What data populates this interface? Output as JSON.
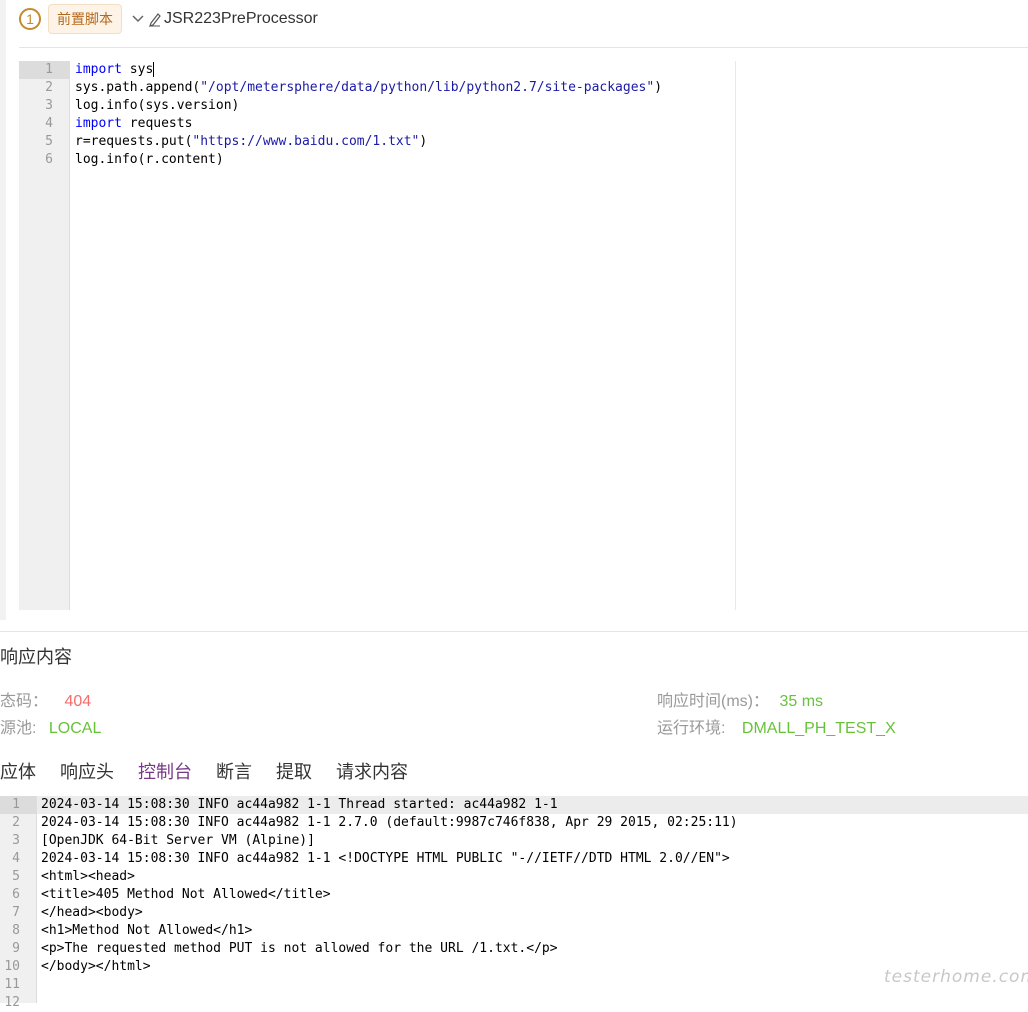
{
  "header": {
    "step_number": "1",
    "tag_label": "前置脚本",
    "title": "JSR223PreProcessor"
  },
  "editor": {
    "line_numbers": [
      "1",
      "2",
      "3",
      "4",
      "5",
      "6"
    ],
    "lines": [
      {
        "kw": "import",
        "rest": " sys"
      },
      {
        "plain": "sys.path.append(",
        "str": "\"/opt/metersphere/data/python/lib/python2.7/site-packages\"",
        "tail": ")"
      },
      {
        "plain": "log.info(sys.version)"
      },
      {
        "kw": "import",
        "rest": " requests"
      },
      {
        "plain": "r=requests.put(",
        "str": "\"https://www.baidu.com/1.txt\"",
        "tail": ")"
      },
      {
        "plain": "log.info(r.content)"
      }
    ]
  },
  "response": {
    "title": "响应内容",
    "status_label": "态码：",
    "status_value": "404",
    "pool_label": "源池:",
    "pool_value": "LOCAL",
    "time_label": "响应时间(ms)：",
    "time_value": "35 ms",
    "env_label": "运行环境:",
    "env_value": "DMALL_PH_TEST_X"
  },
  "tabs": [
    "应体",
    "响应头",
    "控制台",
    "断言",
    "提取",
    "请求内容"
  ],
  "active_tab": 2,
  "console": {
    "line_numbers": [
      "1",
      "2",
      "3",
      "4",
      "5",
      "6",
      "7",
      "8",
      "9",
      "10",
      "11",
      "12"
    ],
    "lines": [
      "2024-03-14 15:08:30 INFO ac44a982 1-1 Thread started: ac44a982 1-1",
      "2024-03-14 15:08:30 INFO ac44a982 1-1 2.7.0 (default:9987c746f838, Apr 29 2015, 02:25:11)",
      "[OpenJDK 64-Bit Server VM (Alpine)]",
      "2024-03-14 15:08:30 INFO ac44a982 1-1 <!DOCTYPE HTML PUBLIC \"-//IETF//DTD HTML 2.0//EN\">",
      "<html><head>",
      "<title>405 Method Not Allowed</title>",
      "</head><body>",
      "<h1>Method Not Allowed</h1>",
      "<p>The requested method PUT is not allowed for the URL /1.txt.</p>",
      "</body></html>",
      "",
      ""
    ]
  },
  "watermark": "testerhome.com"
}
